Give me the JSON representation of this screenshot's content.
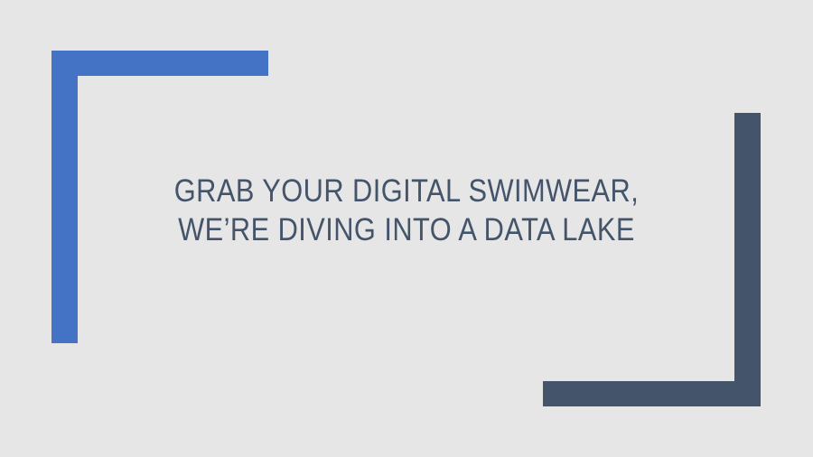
{
  "slide": {
    "title_lines": [
      "GRAB YOUR DIGITAL SWIMWEAR,",
      "WE’RE DIVING INTO A DATA LAKE"
    ]
  },
  "colors": {
    "background": "#e7e6e6",
    "accent_blue": "#4472c4",
    "accent_slate": "#44546a",
    "title_text": "#44546a"
  }
}
